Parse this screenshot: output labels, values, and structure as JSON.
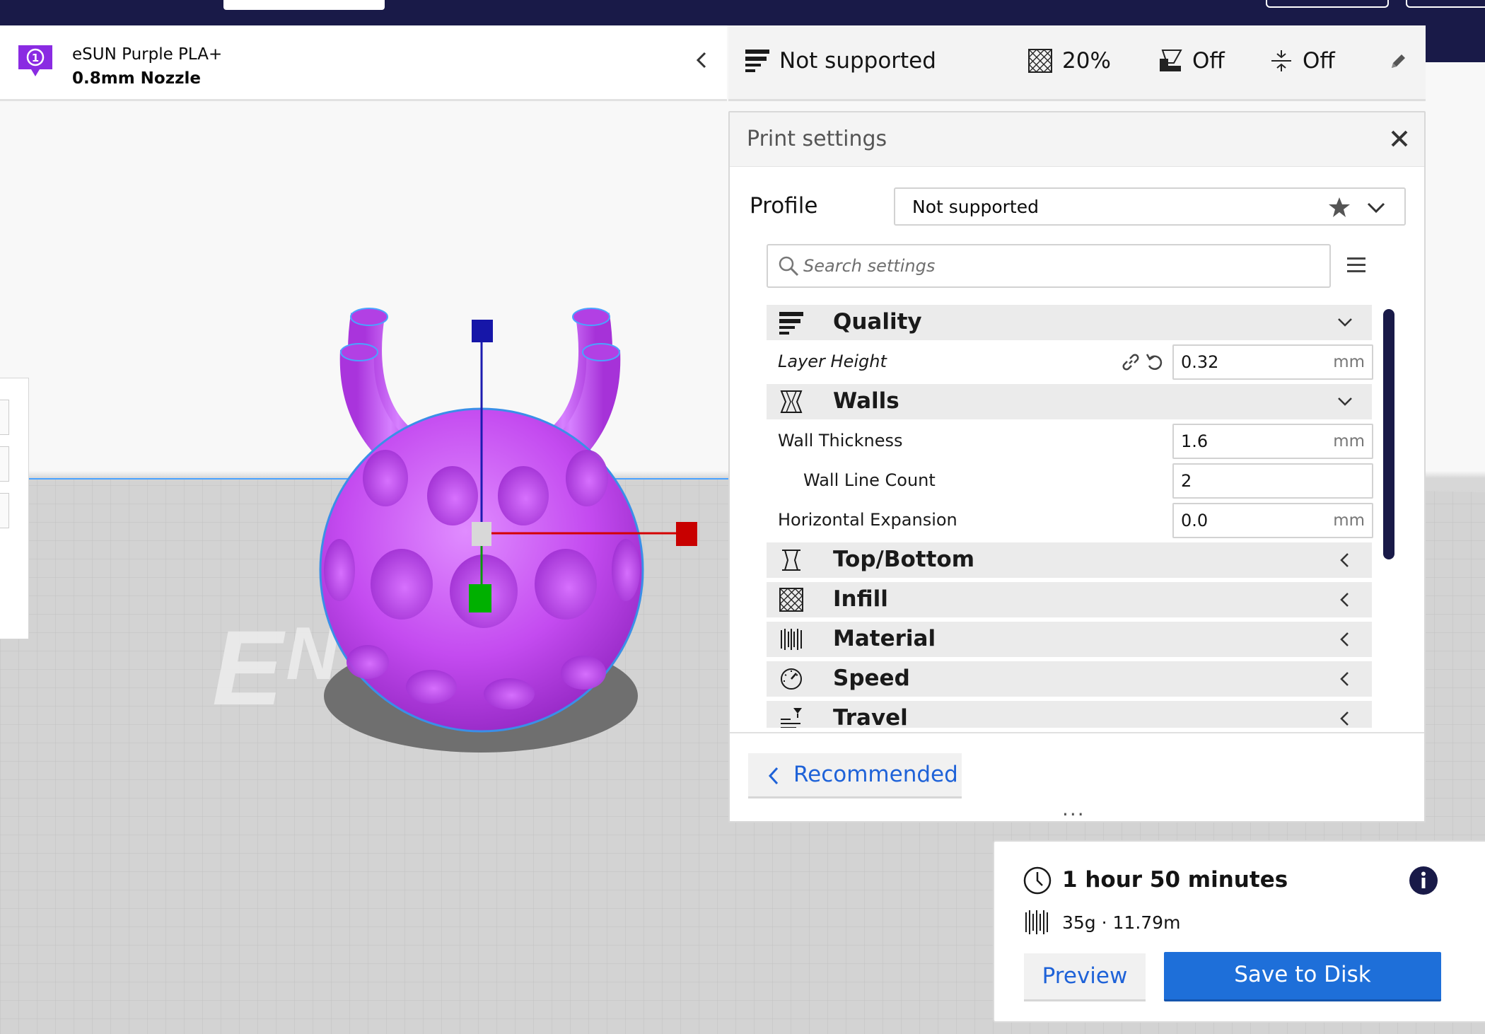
{
  "printer": {
    "badge_number": "1",
    "material": "eSUN Purple PLA+",
    "nozzle": "0.8mm Nozzle"
  },
  "summary_bar": {
    "profile": "Not supported",
    "infill": "20%",
    "support": "Off",
    "adhesion": "Off"
  },
  "print_settings": {
    "title": "Print settings",
    "profile_label": "Profile",
    "profile_value": "Not supported",
    "search_placeholder": "Search settings",
    "categories": {
      "quality": "Quality",
      "walls": "Walls",
      "top_bottom": "Top/Bottom",
      "infill": "Infill",
      "material": "Material",
      "speed": "Speed",
      "travel": "Travel"
    },
    "settings": {
      "layer_height": {
        "label": "Layer Height",
        "value": "0.32",
        "unit": "mm"
      },
      "wall_thickness": {
        "label": "Wall Thickness",
        "value": "1.6",
        "unit": "mm"
      },
      "wall_line_count": {
        "label": "Wall Line Count",
        "value": "2"
      },
      "horizontal_expansion": {
        "label": "Horizontal Expansion",
        "value": "0.0",
        "unit": "mm"
      }
    },
    "recommended_label": "Recommended"
  },
  "estimate": {
    "time": "1 hour 50 minutes",
    "material": "35g · 11.79m",
    "preview_label": "Preview",
    "save_label": "Save to Disk"
  },
  "colors": {
    "brand_dark": "#191a48",
    "accent_blue": "#1e6fd9",
    "model_purple": "#c44bf0",
    "badge_purple": "#8a2be2"
  }
}
